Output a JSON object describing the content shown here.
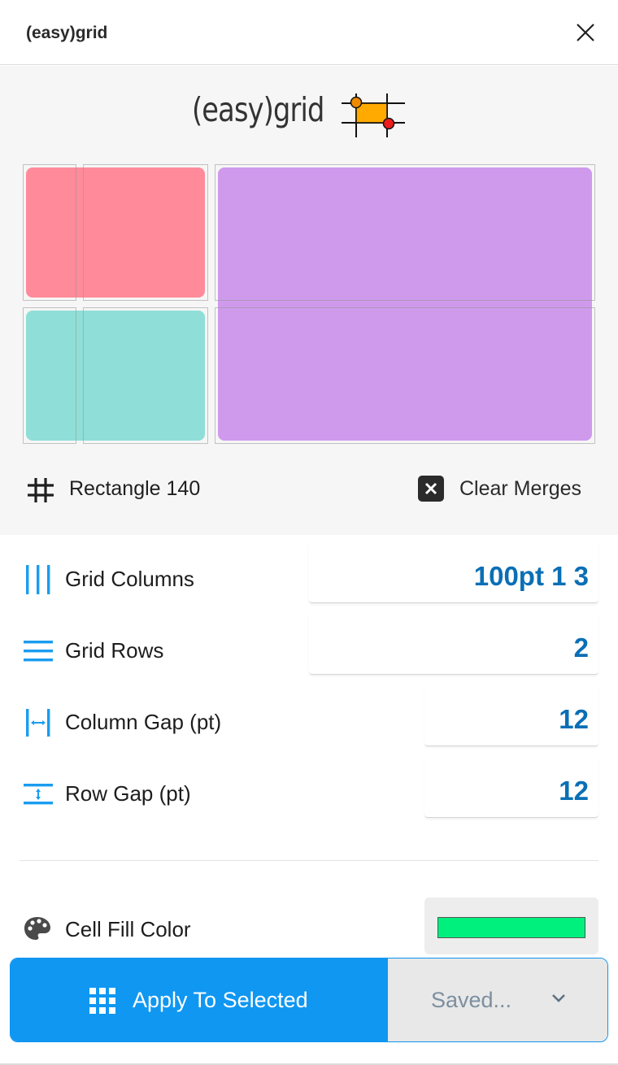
{
  "window": {
    "title": "(easy)grid",
    "close_icon": "close-icon"
  },
  "hero": {
    "logo_text": "(easy)grid",
    "logo_icon": "grid-logo-icon",
    "preview_cells": [
      {
        "name": "merged-top-left",
        "color": "#ff8b9a"
      },
      {
        "name": "merged-bottom-left",
        "color": "#8fdfd8"
      },
      {
        "name": "merged-right",
        "color": "#cf9aec"
      }
    ],
    "layer": {
      "icon": "hash-icon",
      "name": "Rectangle 140"
    },
    "clear_merges": {
      "icon": "close-square-icon",
      "label": "Clear Merges"
    }
  },
  "settings": {
    "grid_columns": {
      "icon": "columns-icon",
      "label": "Grid Columns",
      "value": "100pt 1 3"
    },
    "grid_rows": {
      "icon": "rows-icon",
      "label": "Grid Rows",
      "value": "2"
    },
    "column_gap": {
      "icon": "column-gap-icon",
      "label": "Column Gap (pt)",
      "value": "12"
    },
    "row_gap": {
      "icon": "row-gap-icon",
      "label": "Row Gap (pt)",
      "value": "12"
    },
    "cell_fill": {
      "icon": "palette-icon",
      "label": "Cell Fill Color",
      "color": "#00f07e"
    }
  },
  "actions": {
    "apply_icon": "grid-icon",
    "apply_label": "Apply To Selected",
    "saved_label": "Saved...",
    "saved_icon": "chevron-down-icon"
  },
  "colors": {
    "accent": "#0f97f2",
    "value_text": "#0a6fb5",
    "icon_blue": "#1a9cf0"
  }
}
